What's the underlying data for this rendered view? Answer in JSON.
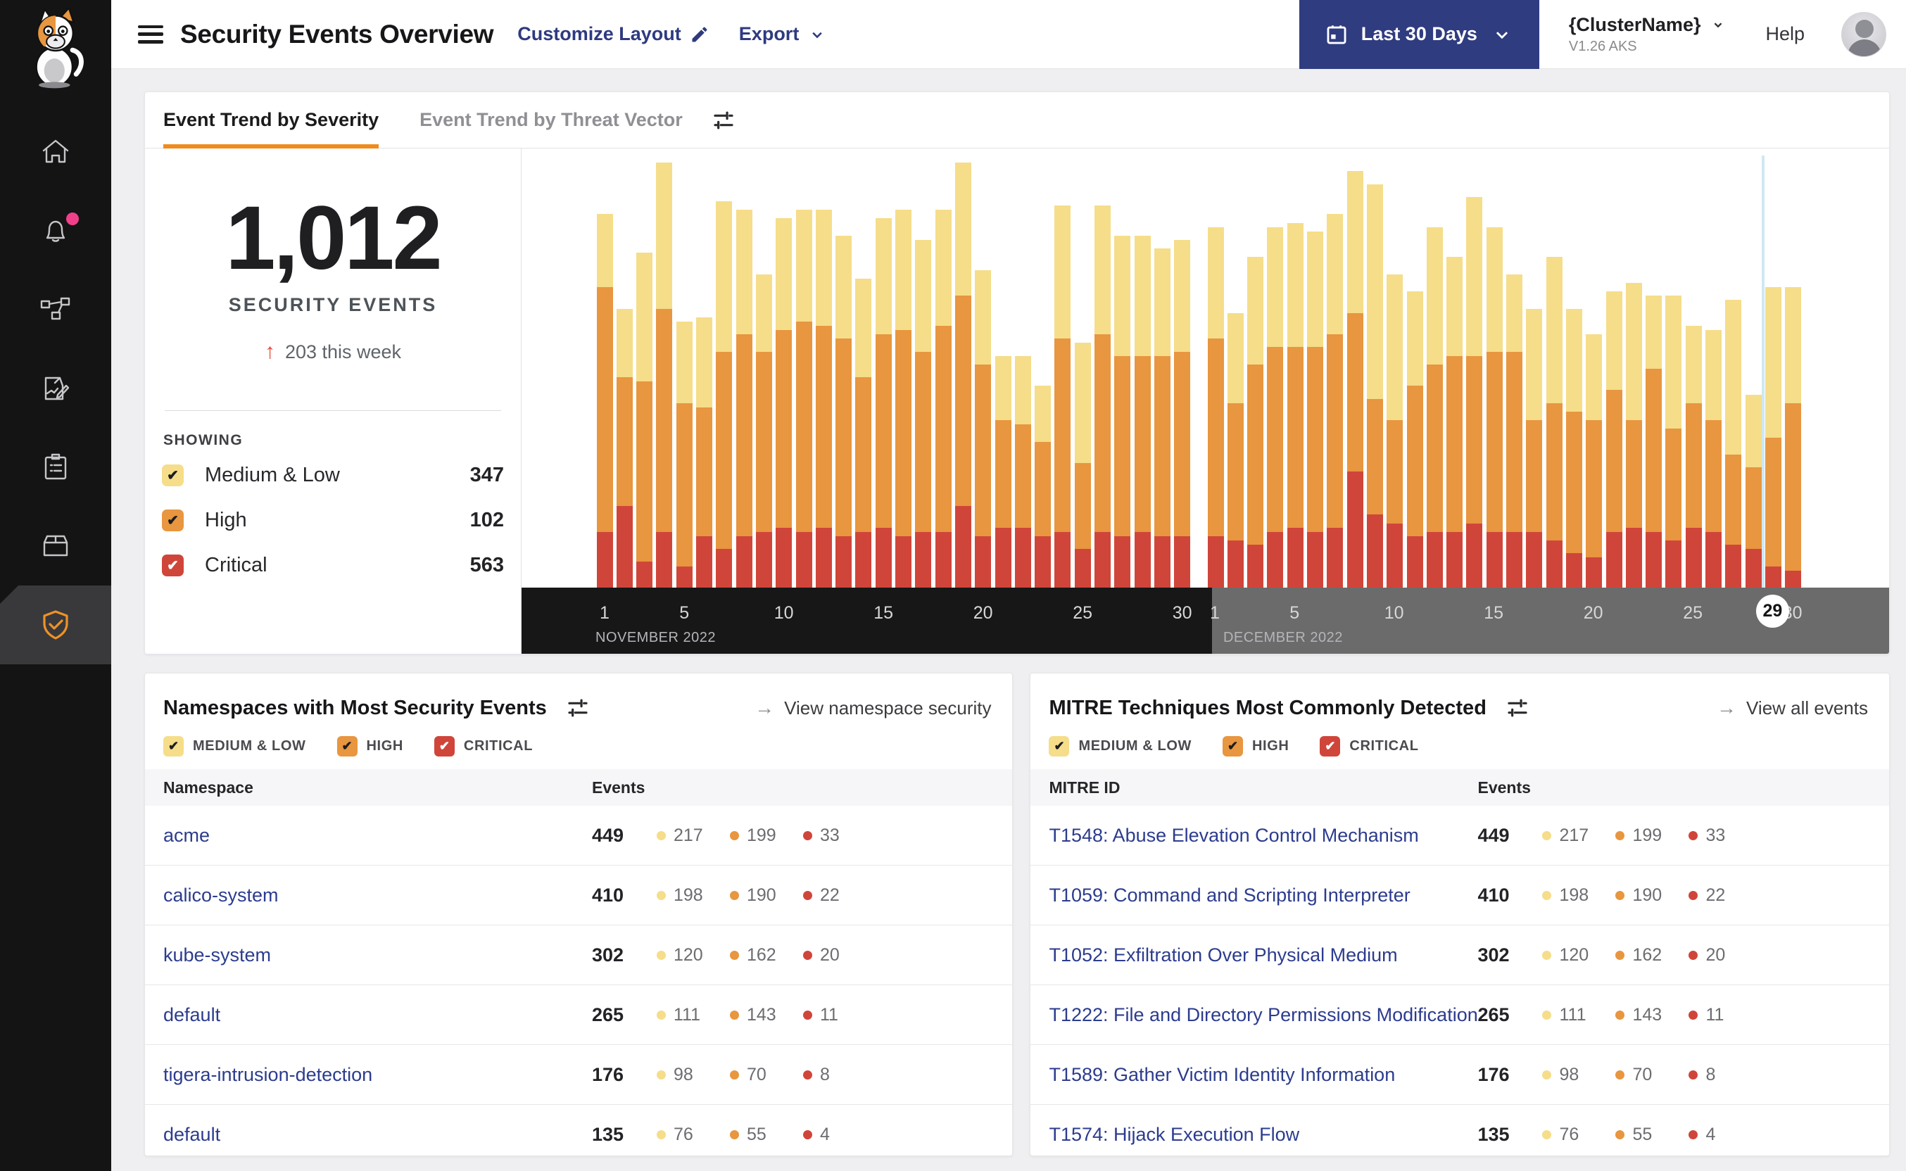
{
  "colors": {
    "medium_low": "#F5DD8A",
    "high": "#E8963F",
    "critical": "#D0453A",
    "accent_orange": "#F08B1D",
    "link_blue": "#2C3C8E",
    "header_link": "#2E3A80",
    "navy_button": "#303C80",
    "notification_pink": "#F0408C"
  },
  "sidebar": {
    "logo": "calico-cat-logo",
    "icons": [
      "home",
      "alerts-bell",
      "service-graph",
      "policy-edit",
      "compliance-clipboard",
      "workloads-box",
      "threat-defense-shield"
    ],
    "active": "threat-defense-shield"
  },
  "header": {
    "title": "Security Events Overview",
    "customize_layout": "Customize Layout",
    "export_label": "Export",
    "date_range": "Last 30 Days",
    "cluster_name": "{ClusterName}",
    "cluster_version": "V1.26 AKS",
    "help": "Help"
  },
  "tabs": {
    "active": "Event Trend by Severity",
    "inactive": "Event Trend by Threat Vector"
  },
  "stats": {
    "total": "1,012",
    "label": "SECURITY EVENTS",
    "delta_arrow": "↑",
    "delta": "203 this week",
    "showing": "SHOWING",
    "legend": [
      {
        "key": "medium_low",
        "label": "Medium & Low",
        "count": "347",
        "checked": true
      },
      {
        "key": "high",
        "label": "High",
        "count": "102",
        "checked": true
      },
      {
        "key": "critical",
        "label": "Critical",
        "count": "563",
        "checked": true
      }
    ]
  },
  "chart_data": {
    "type": "bar",
    "stacked": true,
    "series_names": [
      "Critical",
      "High",
      "Medium & Low"
    ],
    "series_colors": {
      "critical": "#D0453A",
      "high": "#E8963F",
      "medium_low": "#F5DD8A"
    },
    "value_units": "relative height, % of plot (no y-axis labels shown)",
    "day_value_order": [
      "critical",
      "high",
      "medium_low"
    ],
    "highlight": {
      "month": "DECEMBER 2022",
      "day": 29
    },
    "months": [
      {
        "label": "NOVEMBER 2022",
        "ticks": [
          1,
          5,
          10,
          15,
          20,
          25,
          30
        ],
        "days": [
          [
            13,
            57,
            17
          ],
          [
            19,
            30,
            16
          ],
          [
            6,
            42,
            30
          ],
          [
            13,
            52,
            34
          ],
          [
            5,
            38,
            19
          ],
          [
            12,
            30,
            21
          ],
          [
            9,
            46,
            35
          ],
          [
            12,
            47,
            29
          ],
          [
            13,
            42,
            18
          ],
          [
            14,
            46,
            26
          ],
          [
            13,
            49,
            26
          ],
          [
            14,
            47,
            27
          ],
          [
            12,
            46,
            24
          ],
          [
            13,
            36,
            23
          ],
          [
            14,
            45,
            27
          ],
          [
            12,
            48,
            28
          ],
          [
            13,
            42,
            26
          ],
          [
            13,
            48,
            27
          ],
          [
            19,
            49,
            31
          ],
          [
            12,
            40,
            22
          ],
          [
            14,
            25,
            15
          ],
          [
            14,
            24,
            16
          ],
          [
            12,
            22,
            13
          ],
          [
            13,
            45,
            31
          ],
          [
            9,
            20,
            28
          ],
          [
            13,
            46,
            30
          ],
          [
            12,
            42,
            28
          ],
          [
            13,
            41,
            28
          ],
          [
            12,
            42,
            25
          ],
          [
            12,
            43,
            26
          ]
        ]
      },
      {
        "label": "DECEMBER 2022",
        "ticks": [
          1,
          5,
          10,
          15,
          20,
          25,
          29,
          30
        ],
        "days": [
          [
            12,
            46,
            26
          ],
          [
            11,
            32,
            21
          ],
          [
            10,
            42,
            25
          ],
          [
            13,
            43,
            28
          ],
          [
            14,
            42,
            29
          ],
          [
            13,
            43,
            27
          ],
          [
            14,
            45,
            28
          ],
          [
            27,
            37,
            33
          ],
          [
            17,
            27,
            50
          ],
          [
            15,
            24,
            34
          ],
          [
            12,
            35,
            22
          ],
          [
            13,
            39,
            32
          ],
          [
            13,
            41,
            23
          ],
          [
            15,
            39,
            37
          ],
          [
            13,
            42,
            29
          ],
          [
            13,
            42,
            18
          ],
          [
            13,
            26,
            26
          ],
          [
            11,
            32,
            34
          ],
          [
            8,
            33,
            24
          ],
          [
            7,
            32,
            20
          ],
          [
            13,
            33,
            23
          ],
          [
            14,
            25,
            32
          ],
          [
            13,
            38,
            17
          ],
          [
            11,
            26,
            31
          ],
          [
            14,
            29,
            18
          ],
          [
            13,
            26,
            21
          ],
          [
            10,
            21,
            36
          ],
          [
            9,
            19,
            17
          ],
          [
            5,
            30,
            35
          ],
          [
            4,
            39,
            27
          ]
        ]
      }
    ]
  },
  "panels": {
    "filters": [
      {
        "key": "medium_low",
        "label": "MEDIUM & LOW",
        "checked": true
      },
      {
        "key": "high",
        "label": "HIGH",
        "checked": true
      },
      {
        "key": "critical",
        "label": "CRITICAL",
        "checked": true
      }
    ],
    "namespaces": {
      "title": "Namespaces with Most Security Events",
      "link": "View namespace security",
      "link_arrow": "→",
      "columns": [
        "Namespace",
        "Events"
      ],
      "rows": [
        {
          "name": "acme",
          "total": "449",
          "medium_low": "217",
          "high": "199",
          "critical": "33"
        },
        {
          "name": "calico-system",
          "total": "410",
          "medium_low": "198",
          "high": "190",
          "critical": "22"
        },
        {
          "name": "kube-system",
          "total": "302",
          "medium_low": "120",
          "high": "162",
          "critical": "20"
        },
        {
          "name": "default",
          "total": "265",
          "medium_low": "111",
          "high": "143",
          "critical": "11"
        },
        {
          "name": "tigera-intrusion-detection",
          "total": "176",
          "medium_low": "98",
          "high": "70",
          "critical": "8"
        },
        {
          "name": "default",
          "total": "135",
          "medium_low": "76",
          "high": "55",
          "critical": "4"
        }
      ]
    },
    "mitre": {
      "title": "MITRE Techniques Most Commonly Detected",
      "link": "View all events",
      "link_arrow": "→",
      "columns": [
        "MITRE ID",
        "Events"
      ],
      "rows": [
        {
          "name": "T1548: Abuse Elevation Control Mechanism",
          "total": "449",
          "medium_low": "217",
          "high": "199",
          "critical": "33"
        },
        {
          "name": "T1059: Command and Scripting Interpreter",
          "total": "410",
          "medium_low": "198",
          "high": "190",
          "critical": "22"
        },
        {
          "name": "T1052: Exfiltration Over Physical Medium",
          "total": "302",
          "medium_low": "120",
          "high": "162",
          "critical": "20"
        },
        {
          "name": "T1222: File and Directory Permissions Modification",
          "total": "265",
          "medium_low": "111",
          "high": "143",
          "critical": "11"
        },
        {
          "name": "T1589: Gather Victim Identity Information",
          "total": "176",
          "medium_low": "98",
          "high": "70",
          "critical": "8"
        },
        {
          "name": "T1574: Hijack Execution Flow",
          "total": "135",
          "medium_low": "76",
          "high": "55",
          "critical": "4"
        }
      ]
    }
  }
}
